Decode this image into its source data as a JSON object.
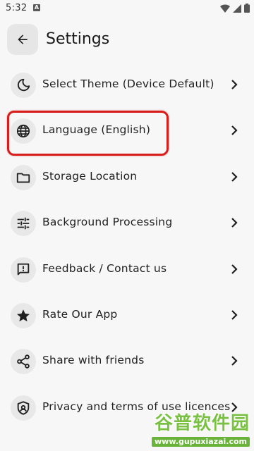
{
  "status_bar": {
    "time": "5:32",
    "notif_badge": "A"
  },
  "header": {
    "title": "Settings"
  },
  "items": [
    {
      "label": "Select Theme (Device Default)",
      "icon": "moon-icon"
    },
    {
      "label": "Language (English)",
      "icon": "globe-icon"
    },
    {
      "label": "Storage Location",
      "icon": "folder-icon"
    },
    {
      "label": "Background Processing",
      "icon": "tune-sliders-icon"
    },
    {
      "label": "Feedback / Contact us",
      "icon": "feedback-icon"
    },
    {
      "label": "Rate Our App",
      "icon": "star-icon"
    },
    {
      "label": "Share with friends",
      "icon": "share-icon"
    },
    {
      "label": "Privacy and terms of use licences",
      "icon": "privacy-shield-icon"
    }
  ],
  "highlight_color": "#d81d1d",
  "watermark": {
    "title": "谷普软件园",
    "url": "www.gupuxiazai.com"
  }
}
